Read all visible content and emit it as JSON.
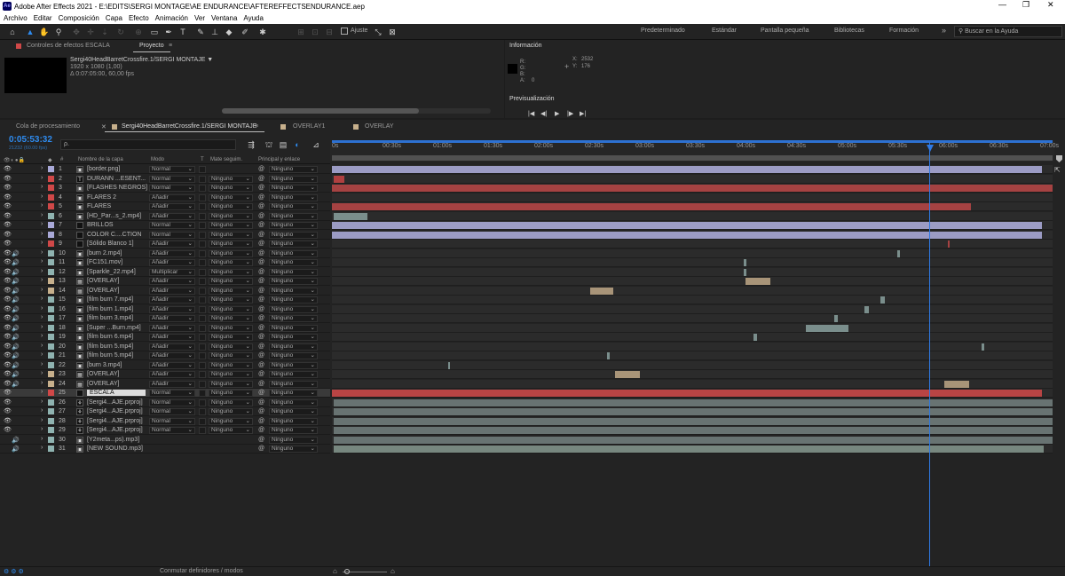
{
  "window": {
    "app_abbr": "Ae",
    "title": "Adobe After Effects 2021 - E:\\EDITS\\SERGI MONTAGE\\AE ENDURANCE\\AFTEREFFECTSENDURANCE.aep"
  },
  "menu": [
    "Archivo",
    "Editar",
    "Composición",
    "Capa",
    "Efecto",
    "Animación",
    "Ver",
    "Ventana",
    "Ayuda"
  ],
  "toolbar": {
    "ajuste_label": "Ajuste",
    "workspaces": [
      "Predeterminado",
      "Estándar",
      "Pantalla pequeña",
      "Bibliotecas",
      "Formación"
    ],
    "search_placeholder": "Buscar en la Ayuda"
  },
  "left_panel": {
    "tab_effects": "Controles de efectos ESCALA",
    "tab_project": "Proyecto",
    "item_name": "Sergi40HeadBarretCrossfire.1/SERGI MONTAJE ▼",
    "item_res": "1920 x 1080 (1,00)",
    "item_dur": "Δ 0:07:05:00, 60,00 fps"
  },
  "info_panel": {
    "title": "Información",
    "r": "R:",
    "g": "G:",
    "b": "B:",
    "a": "A:",
    "a_value": "0",
    "x": "X:",
    "x_value": "2532",
    "y": "Y:",
    "y_value": "176",
    "preview_title": "Previsualización"
  },
  "timeline": {
    "tabs": [
      "Cola de procesamiento",
      "Sergi40HeadBarretCrossfire.1/SERGI MONTAJE",
      "OVERLAY1",
      "OVERLAY"
    ],
    "timecode": "0:05:53:32",
    "timecode_sub": "21232 (60.00 fps)",
    "search_placeholder": "ρ.",
    "col_headers": {
      "num": "#",
      "name": "Nombre de la capa",
      "mode": "Modo",
      "t": "T",
      "matte": "Mate seguim.",
      "parent": "Principal y enlace"
    },
    "ruler": [
      "0s",
      "00:30s",
      "01:00s",
      "01:30s",
      "02:00s",
      "02:30s",
      "03:00s",
      "03:30s",
      "04:00s",
      "04:30s",
      "05:00s",
      "05:30s",
      "06:00s",
      "06:30s",
      "07:00s"
    ],
    "footer_label": "Conmutar definidores / modos",
    "layers": [
      {
        "n": "1",
        "name": "[border.png]",
        "mode": "Normal",
        "matte": "",
        "parent": "Ninguno",
        "color": "#a9a9d8",
        "icon": "img"
      },
      {
        "n": "2",
        "name": "DURANN ...ESENT...",
        "mode": "Normal",
        "matte": "Ninguno",
        "parent": "Ninguno",
        "color": "#d04848",
        "icon": "T"
      },
      {
        "n": "3",
        "name": "[FLASHES NEGROS]",
        "mode": "Normal",
        "matte": "Ninguno",
        "parent": "Ninguno",
        "color": "#d04848",
        "icon": "solid"
      },
      {
        "n": "4",
        "name": "FLARES 2",
        "mode": "Añadir",
        "matte": "Ninguno",
        "parent": "Ninguno",
        "color": "#d04848",
        "icon": "solid"
      },
      {
        "n": "5",
        "name": "FLARES",
        "mode": "Añadir",
        "matte": "Ninguno",
        "parent": "Ninguno",
        "color": "#d04848",
        "icon": "solid"
      },
      {
        "n": "6",
        "name": "[HD_Par...s_2.mp4]",
        "mode": "Añadir",
        "matte": "Ninguno",
        "parent": "Ninguno",
        "color": "#8fb3b0",
        "icon": "img"
      },
      {
        "n": "7",
        "name": "BRILLOS",
        "mode": "Normal",
        "matte": "Ninguno",
        "parent": "Ninguno",
        "color": "#a9a9d8",
        "icon": "solidw"
      },
      {
        "n": "8",
        "name": "COLOR C....CTION",
        "mode": "Normal",
        "matte": "Ninguno",
        "parent": "Ninguno",
        "color": "#a9a9d8",
        "icon": "solidw"
      },
      {
        "n": "9",
        "name": "[Sólido Blanco 1]",
        "mode": "Añadir",
        "matte": "Ninguno",
        "parent": "Ninguno",
        "color": "#d04848",
        "icon": "solidw"
      },
      {
        "n": "10",
        "name": "[burn 2.mp4]",
        "mode": "Añadir",
        "matte": "Ninguno",
        "parent": "Ninguno",
        "color": "#8fb3b0",
        "icon": "img"
      },
      {
        "n": "11",
        "name": "[FC151.mov]",
        "mode": "Añadir",
        "matte": "Ninguno",
        "parent": "Ninguno",
        "color": "#8fb3b0",
        "icon": "img"
      },
      {
        "n": "12",
        "name": "[Sparkle_22.mp4]",
        "mode": "Multiplicar",
        "matte": "Ninguno",
        "parent": "Ninguno",
        "color": "#8fb3b0",
        "icon": "img"
      },
      {
        "n": "13",
        "name": "[OVERLAY]",
        "mode": "Añadir",
        "matte": "Ninguno",
        "parent": "Ninguno",
        "color": "#c7b08c",
        "icon": "comp"
      },
      {
        "n": "14",
        "name": "[OVERLAY]",
        "mode": "Añadir",
        "matte": "Ninguno",
        "parent": "Ninguno",
        "color": "#c7b08c",
        "icon": "comp"
      },
      {
        "n": "15",
        "name": "[film burn 7.mp4]",
        "mode": "Añadir",
        "matte": "Ninguno",
        "parent": "Ninguno",
        "color": "#8fb3b0",
        "icon": "img"
      },
      {
        "n": "16",
        "name": "[film burn 1.mp4]",
        "mode": "Añadir",
        "matte": "Ninguno",
        "parent": "Ninguno",
        "color": "#8fb3b0",
        "icon": "img"
      },
      {
        "n": "17",
        "name": "[film burn 3.mp4]",
        "mode": "Añadir",
        "matte": "Ninguno",
        "parent": "Ninguno",
        "color": "#8fb3b0",
        "icon": "img"
      },
      {
        "n": "18",
        "name": "[Super ...Burn.mp4]",
        "mode": "Añadir",
        "matte": "Ninguno",
        "parent": "Ninguno",
        "color": "#8fb3b0",
        "icon": "img"
      },
      {
        "n": "19",
        "name": "[film burn 6.mp4]",
        "mode": "Añadir",
        "matte": "Ninguno",
        "parent": "Ninguno",
        "color": "#8fb3b0",
        "icon": "img"
      },
      {
        "n": "20",
        "name": "[film burn 5.mp4]",
        "mode": "Añadir",
        "matte": "Ninguno",
        "parent": "Ninguno",
        "color": "#8fb3b0",
        "icon": "img"
      },
      {
        "n": "21",
        "name": "[film burn 5.mp4]",
        "mode": "Añadir",
        "matte": "Ninguno",
        "parent": "Ninguno",
        "color": "#8fb3b0",
        "icon": "img"
      },
      {
        "n": "22",
        "name": "[burn 3.mp4]",
        "mode": "Añadir",
        "matte": "Ninguno",
        "parent": "Ninguno",
        "color": "#8fb3b0",
        "icon": "img"
      },
      {
        "n": "23",
        "name": "[OVERLAY]",
        "mode": "Añadir",
        "matte": "Ninguno",
        "parent": "Ninguno",
        "color": "#c7b08c",
        "icon": "comp"
      },
      {
        "n": "24",
        "name": "[OVERLAY]",
        "mode": "Añadir",
        "matte": "Ninguno",
        "parent": "Ninguno",
        "color": "#c7b08c",
        "icon": "comp"
      },
      {
        "n": "25",
        "name": "ESCALA",
        "mode": "Normal",
        "matte": "Ninguno",
        "parent": "Ninguno",
        "color": "#d04848",
        "icon": "solidw",
        "selected": true
      },
      {
        "n": "26",
        "name": "[Sergi4...AJE.prproj]",
        "mode": "Normal",
        "matte": "Ninguno",
        "parent": "Ninguno",
        "color": "#8fb3b0",
        "icon": "seq"
      },
      {
        "n": "27",
        "name": "[Sergi4...AJE.prproj]",
        "mode": "Normal",
        "matte": "Ninguno",
        "parent": "Ninguno",
        "color": "#8fb3b0",
        "icon": "seq"
      },
      {
        "n": "28",
        "name": "[Sergi4...AJE.prproj]",
        "mode": "Normal",
        "matte": "Ninguno",
        "parent": "Ninguno",
        "color": "#8fb3b0",
        "icon": "seq"
      },
      {
        "n": "29",
        "name": "[Sergi4...AJE.prproj]",
        "mode": "Normal",
        "matte": "Ninguno",
        "parent": "Ninguno",
        "color": "#8fb3b0",
        "icon": "seq"
      },
      {
        "n": "30",
        "name": "[Y2meta...ps).mp3]",
        "mode": "",
        "matte": "",
        "parent": "Ninguno",
        "color": "#8fb3b0",
        "icon": "img"
      },
      {
        "n": "31",
        "name": "[NEW SOUND.mp3]",
        "mode": "",
        "matte": "",
        "parent": "Ninguno",
        "color": "#8fb3b0",
        "icon": "img"
      }
    ]
  }
}
